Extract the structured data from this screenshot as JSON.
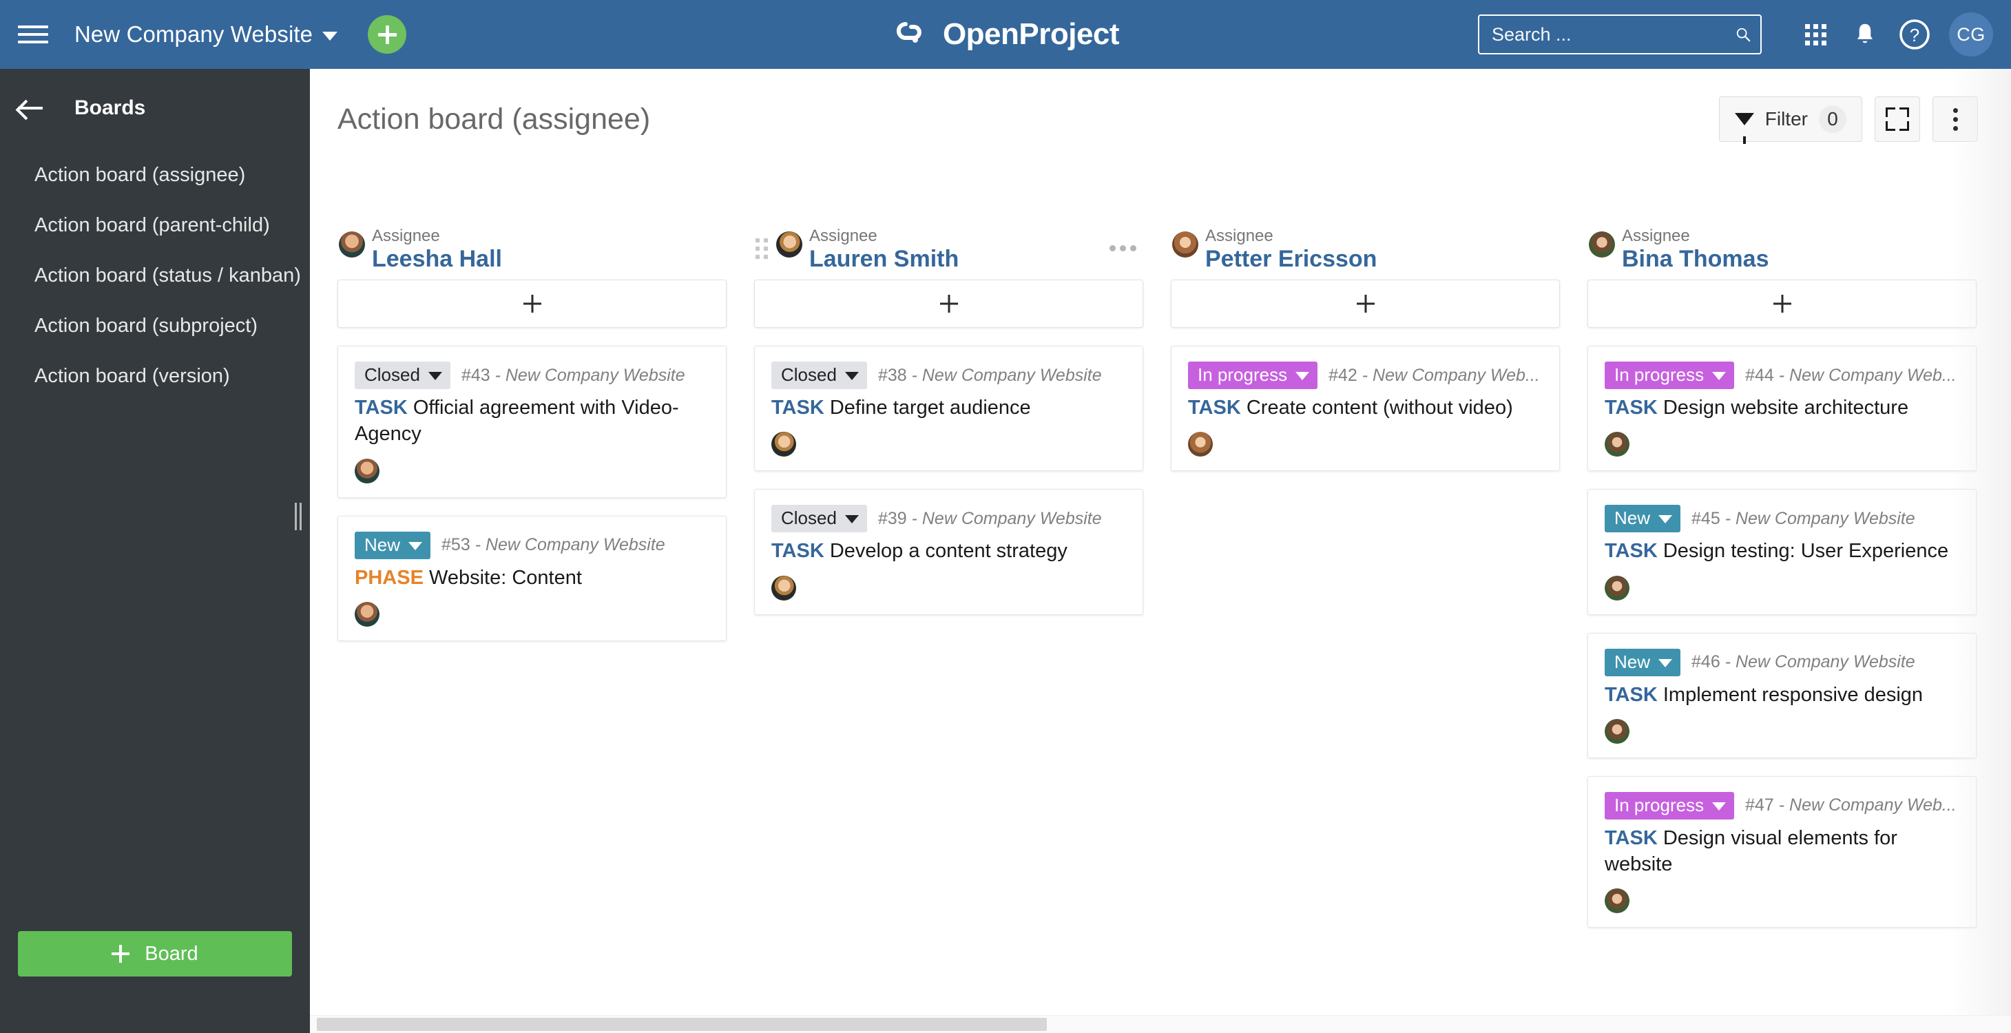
{
  "topbar": {
    "menu_icon": "hamburger-icon",
    "project_name": "New Company Website",
    "add_icon": "plus-icon",
    "logo_text": "OpenProject",
    "logo_icon": "openproject-logo-icon",
    "search": {
      "placeholder": "Search ...",
      "value": "",
      "icon": "search-icon"
    },
    "modules_icon": "grid-modules-icon",
    "notifications_icon": "bell-icon",
    "help_icon": "question-circle-icon",
    "user_initials": "CG"
  },
  "sidebar": {
    "back_icon": "arrow-left-icon",
    "title": "Boards",
    "items": [
      {
        "label": "Action board (assignee)"
      },
      {
        "label": "Action board (parent-child)"
      },
      {
        "label": "Action board (status / kanban)"
      },
      {
        "label": "Action board (subproject)"
      },
      {
        "label": "Action board (version)"
      }
    ],
    "board_button": "Board",
    "board_button_icon": "plus-icon"
  },
  "page": {
    "title": "Action board (assignee)",
    "toolbar": {
      "filter_label": "Filter",
      "filter_count": "0",
      "filter_icon": "funnel-icon",
      "fullscreen_icon": "expand-icon",
      "more_icon": "more-vertical-icon"
    }
  },
  "colors": {
    "brand_blue": "#35679B",
    "accent_green": "#6FC05E",
    "status_closed_bg": "#E0E2E6",
    "status_new_bg": "#3E92AD",
    "status_inprogress_bg": "#C660DE",
    "type_task": "#35679B",
    "type_phase": "#E5832A",
    "sidebar_bg": "#343A3E"
  },
  "board": {
    "add_card_icon": "plus-icon",
    "columns": [
      {
        "label": "Assignee",
        "name": "Leesha Hall",
        "avatar": "av-leesha",
        "has_drag_handle": false,
        "has_menu": false,
        "cards": [
          {
            "status": "Closed",
            "status_class": "st-closed",
            "id": "#43",
            "project": "- New Company Website",
            "type": "TASK",
            "type_class": "type-task",
            "title": "Official agreement with Video-Agency",
            "avatar": "av-leesha"
          },
          {
            "status": "New",
            "status_class": "st-new",
            "id": "#53",
            "project": "- New Company Website",
            "type": "PHASE",
            "type_class": "type-phase",
            "title": "Website: Content",
            "avatar": "av-leesha"
          }
        ]
      },
      {
        "label": "Assignee",
        "name": "Lauren Smith",
        "avatar": "av-lauren",
        "has_drag_handle": true,
        "has_menu": true,
        "cards": [
          {
            "status": "Closed",
            "status_class": "st-closed",
            "id": "#38",
            "project": "- New Company Website",
            "type": "TASK",
            "type_class": "type-task",
            "title": "Define target audience",
            "avatar": "av-lauren"
          },
          {
            "status": "Closed",
            "status_class": "st-closed",
            "id": "#39",
            "project": "- New Company Website",
            "type": "TASK",
            "type_class": "type-task",
            "title": "Develop a content strategy",
            "avatar": "av-lauren"
          }
        ]
      },
      {
        "label": "Assignee",
        "name": "Petter Ericsson",
        "avatar": "av-petter",
        "has_drag_handle": false,
        "has_menu": false,
        "cards": [
          {
            "status": "In progress",
            "status_class": "st-inprogress",
            "id": "#42",
            "project": "- New Company Web...",
            "type": "TASK",
            "type_class": "type-task",
            "title": "Create content (without video)",
            "avatar": "av-petter"
          }
        ]
      },
      {
        "label": "Assignee",
        "name": "Bina Thomas",
        "avatar": "av-bina",
        "has_drag_handle": false,
        "has_menu": false,
        "cards": [
          {
            "status": "In progress",
            "status_class": "st-inprogress",
            "id": "#44",
            "project": "- New Company Web...",
            "type": "TASK",
            "type_class": "type-task",
            "title": "Design website architecture",
            "avatar": "av-bina"
          },
          {
            "status": "New",
            "status_class": "st-new",
            "id": "#45",
            "project": "- New Company Website",
            "type": "TASK",
            "type_class": "type-task",
            "title": "Design testing: User Experience",
            "avatar": "av-bina"
          },
          {
            "status": "New",
            "status_class": "st-new",
            "id": "#46",
            "project": "- New Company Website",
            "type": "TASK",
            "type_class": "type-task",
            "title": "Implement responsive design",
            "avatar": "av-bina"
          },
          {
            "status": "In progress",
            "status_class": "st-inprogress",
            "id": "#47",
            "project": "- New Company Web...",
            "type": "TASK",
            "type_class": "type-task",
            "title": "Design visual elements for website",
            "avatar": "av-bina"
          }
        ]
      }
    ]
  }
}
